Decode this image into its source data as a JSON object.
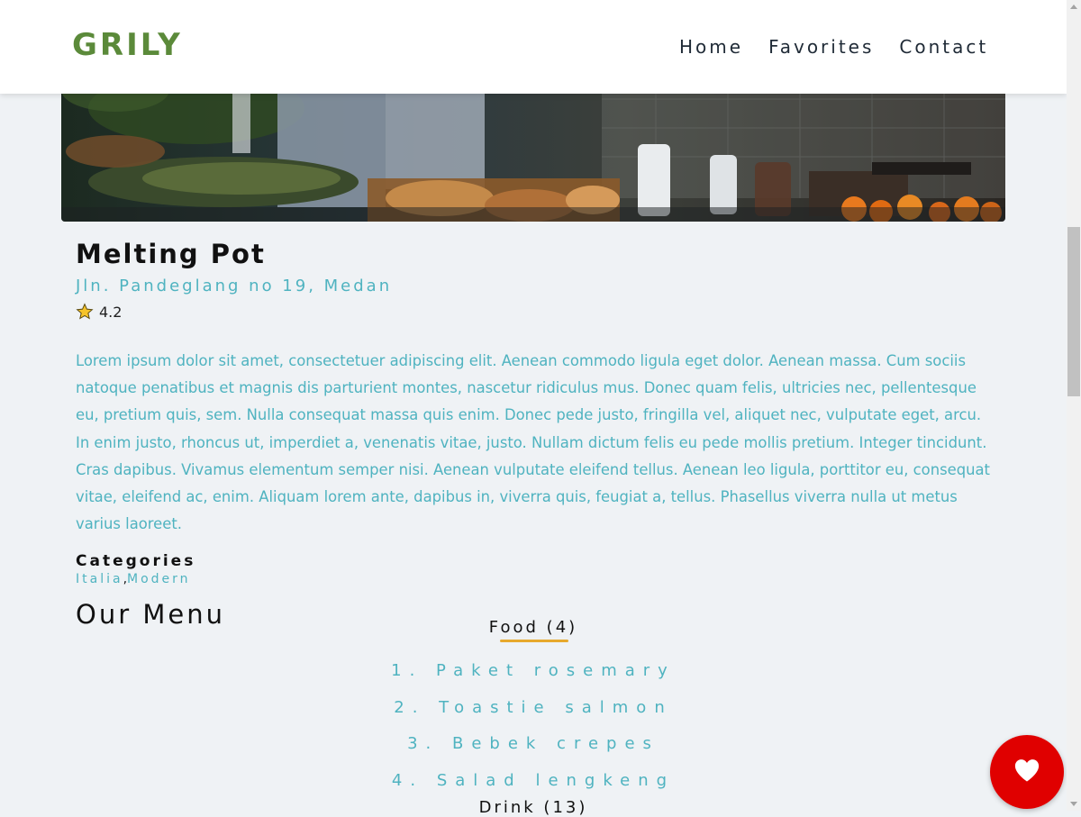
{
  "header": {
    "brand": "GRILY",
    "nav": [
      "Home",
      "Favorites",
      "Contact"
    ]
  },
  "restaurant": {
    "name": "Melting Pot",
    "address": "Jln. Pandeglang no 19, Medan",
    "rating": "4.2",
    "description": "Lorem ipsum dolor sit amet, consectetuer adipiscing elit. Aenean commodo ligula eget dolor. Aenean massa. Cum sociis natoque penatibus et magnis dis parturient montes, nascetur ridiculus mus. Donec quam felis, ultricies nec, pellentesque eu, pretium quis, sem. Nulla consequat massa quis enim. Donec pede justo, fringilla vel, aliquet nec, vulputate eget, arcu. In enim justo, rhoncus ut, imperdiet a, venenatis vitae, justo. Nullam dictum felis eu pede mollis pretium. Integer tincidunt. Cras dapibus. Vivamus elementum semper nisi. Aenean vulputate eleifend tellus. Aenean leo ligula, porttitor eu, consequat vitae, eleifend ac, enim. Aliquam lorem ante, dapibus in, viverra quis, feugiat a, tellus. Phasellus viverra nulla ut metus varius laoreet.",
    "categories_label": "Categories",
    "categories": [
      "Italia",
      "Modern"
    ],
    "category_separator": ","
  },
  "menu": {
    "title": "Our Menu",
    "food_heading": "Food (4)",
    "food_items": [
      "1. Paket rosemary",
      "2. Toastie salmon",
      "3. Bebek crepes",
      "4. Salad lengkeng"
    ],
    "drink_heading": "Drink (13)"
  },
  "colors": {
    "brand": "#5b8a3a",
    "accent_teal": "#4fb3c0",
    "underline": "#e7a92d",
    "favorite_button": "#e00000"
  },
  "icons": {
    "rating": "star-icon",
    "favorite": "heart-icon"
  }
}
